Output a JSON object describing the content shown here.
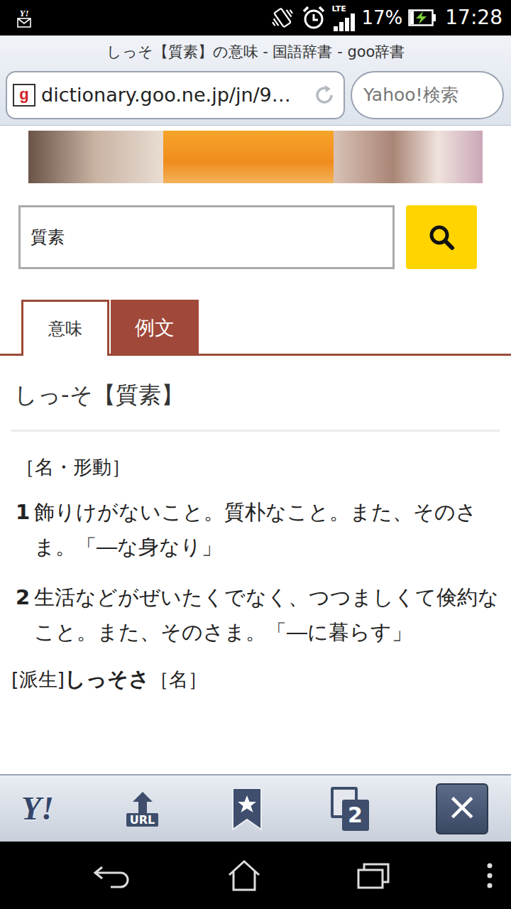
{
  "status_bar": {
    "notification": "Y!",
    "network": "LTE",
    "signal_level": 1,
    "battery": "17%",
    "battery_level": 0.17,
    "charging": true,
    "time": "17:28"
  },
  "browser": {
    "title": "しっそ【質素】の意味 - 国語辞書 - goo辞書",
    "site_icon": "g",
    "url": "dictionary.goo.ne.jp/jn/9…",
    "search_placeholder": "Yahoo!検索"
  },
  "search": {
    "value": "質素"
  },
  "tabs": [
    {
      "label": "意味",
      "selected": true
    },
    {
      "label": "例文",
      "selected": false
    }
  ],
  "entry": {
    "heading": "しっ‐そ【質素】",
    "pos": "［名・形動］",
    "senses": [
      {
        "number": "1",
        "text": "飾りけがないこと。質朴なこと。また、そのさま。「―な身なり」"
      },
      {
        "number": "2",
        "text": "生活などがぜいたくでなく、つつましくて倹約なこと。また、そのさま。「―に暮らす」"
      }
    ],
    "derived_label": "[派生]",
    "derived_word": "しっそさ",
    "derived_pos": "［名］"
  },
  "toolbar": {
    "home": "Y!",
    "url_button": "URL",
    "tab_count": "2",
    "close": "×"
  }
}
